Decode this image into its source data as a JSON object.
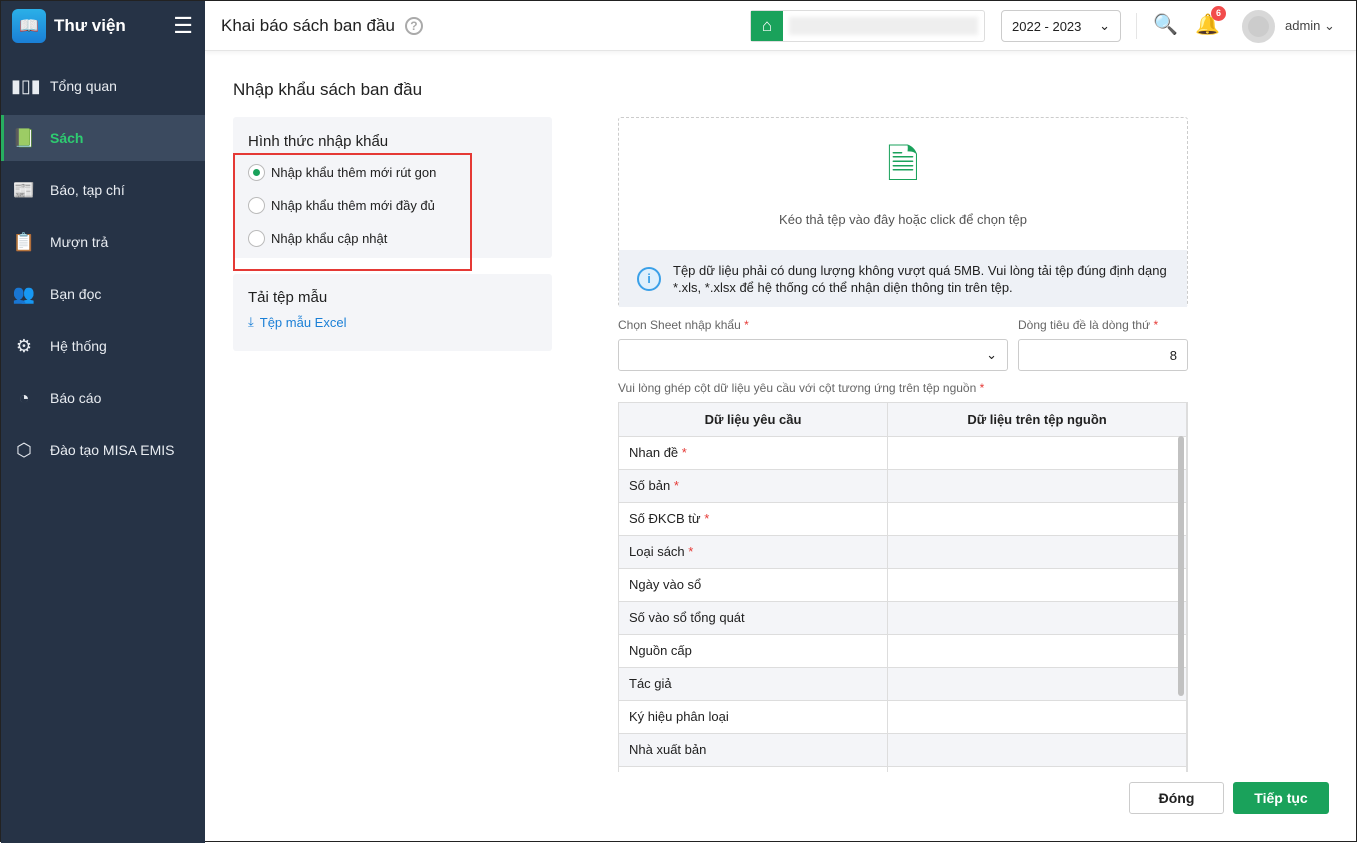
{
  "app": {
    "name": "Thư viện"
  },
  "sidebar": {
    "items": [
      {
        "label": "Tổng quan",
        "icon": "chart-bars-icon"
      },
      {
        "label": "Sách",
        "icon": "book-icon",
        "active": true
      },
      {
        "label": "Báo, tạp chí",
        "icon": "newspaper-icon"
      },
      {
        "label": "Mượn trả",
        "icon": "borrow-icon"
      },
      {
        "label": "Bạn đọc",
        "icon": "reader-icon"
      },
      {
        "label": "Hệ thống",
        "icon": "gear-icon"
      },
      {
        "label": "Báo cáo",
        "icon": "pie-chart-icon"
      },
      {
        "label": "Đào tạo MISA EMIS",
        "icon": "cube-icon"
      }
    ]
  },
  "header": {
    "title": "Khai báo sách ban đầu",
    "year": "2022 - 2023",
    "notifications": "6",
    "user": "admin"
  },
  "main": {
    "title": "Nhập khẩu sách ban đầu",
    "import_type": {
      "title": "Hình thức nhập khẩu",
      "options": [
        "Nhập khẩu thêm mới rút gon",
        "Nhập khẩu thêm mới đầy đủ",
        "Nhập khẩu cập nhật"
      ],
      "selected": 0
    },
    "template": {
      "title": "Tải tệp mẫu",
      "link": "Tệp mẫu Excel"
    },
    "dropzone": {
      "text": "Kéo thả tệp vào đây hoặc click để chọn tệp",
      "info": "Tệp dữ liệu phải có dung lượng không vượt quá 5MB. Vui lòng tải tệp đúng định dạng *.xls, *.xlsx để hệ thống có thể nhận diện thông tin trên tệp."
    },
    "sheet_label": "Chọn Sheet nhập khẩu",
    "sheet_value": "",
    "header_row_label": "Dòng tiêu đề là dòng thứ",
    "header_row_value": "8",
    "mapping_label": "Vui lòng ghép cột dữ liệu yêu cầu với cột tương ứng trên tệp nguồn",
    "table": {
      "columns": [
        "Dữ liệu yêu cầu",
        "Dữ liệu trên tệp nguồn"
      ],
      "rows": [
        {
          "f": "Nhan đề",
          "r": true
        },
        {
          "f": "Số bản",
          "r": true
        },
        {
          "f": "Số ĐKCB từ",
          "r": true
        },
        {
          "f": "Loại sách",
          "r": true
        },
        {
          "f": "Ngày vào sổ",
          "r": false
        },
        {
          "f": "Số vào sổ tổng quát",
          "r": false
        },
        {
          "f": "Nguồn cấp",
          "r": false
        },
        {
          "f": "Tác giả",
          "r": false
        },
        {
          "f": "Ký hiệu phân loại",
          "r": false
        },
        {
          "f": "Nhà xuất bản",
          "r": false
        },
        {
          "f": "",
          "r": false
        }
      ]
    },
    "buttons": {
      "close": "Đóng",
      "next": "Tiếp tục"
    }
  },
  "colors": {
    "primary": "#1aa25b",
    "sidebar": "#263346",
    "highlight": "#e53935"
  }
}
